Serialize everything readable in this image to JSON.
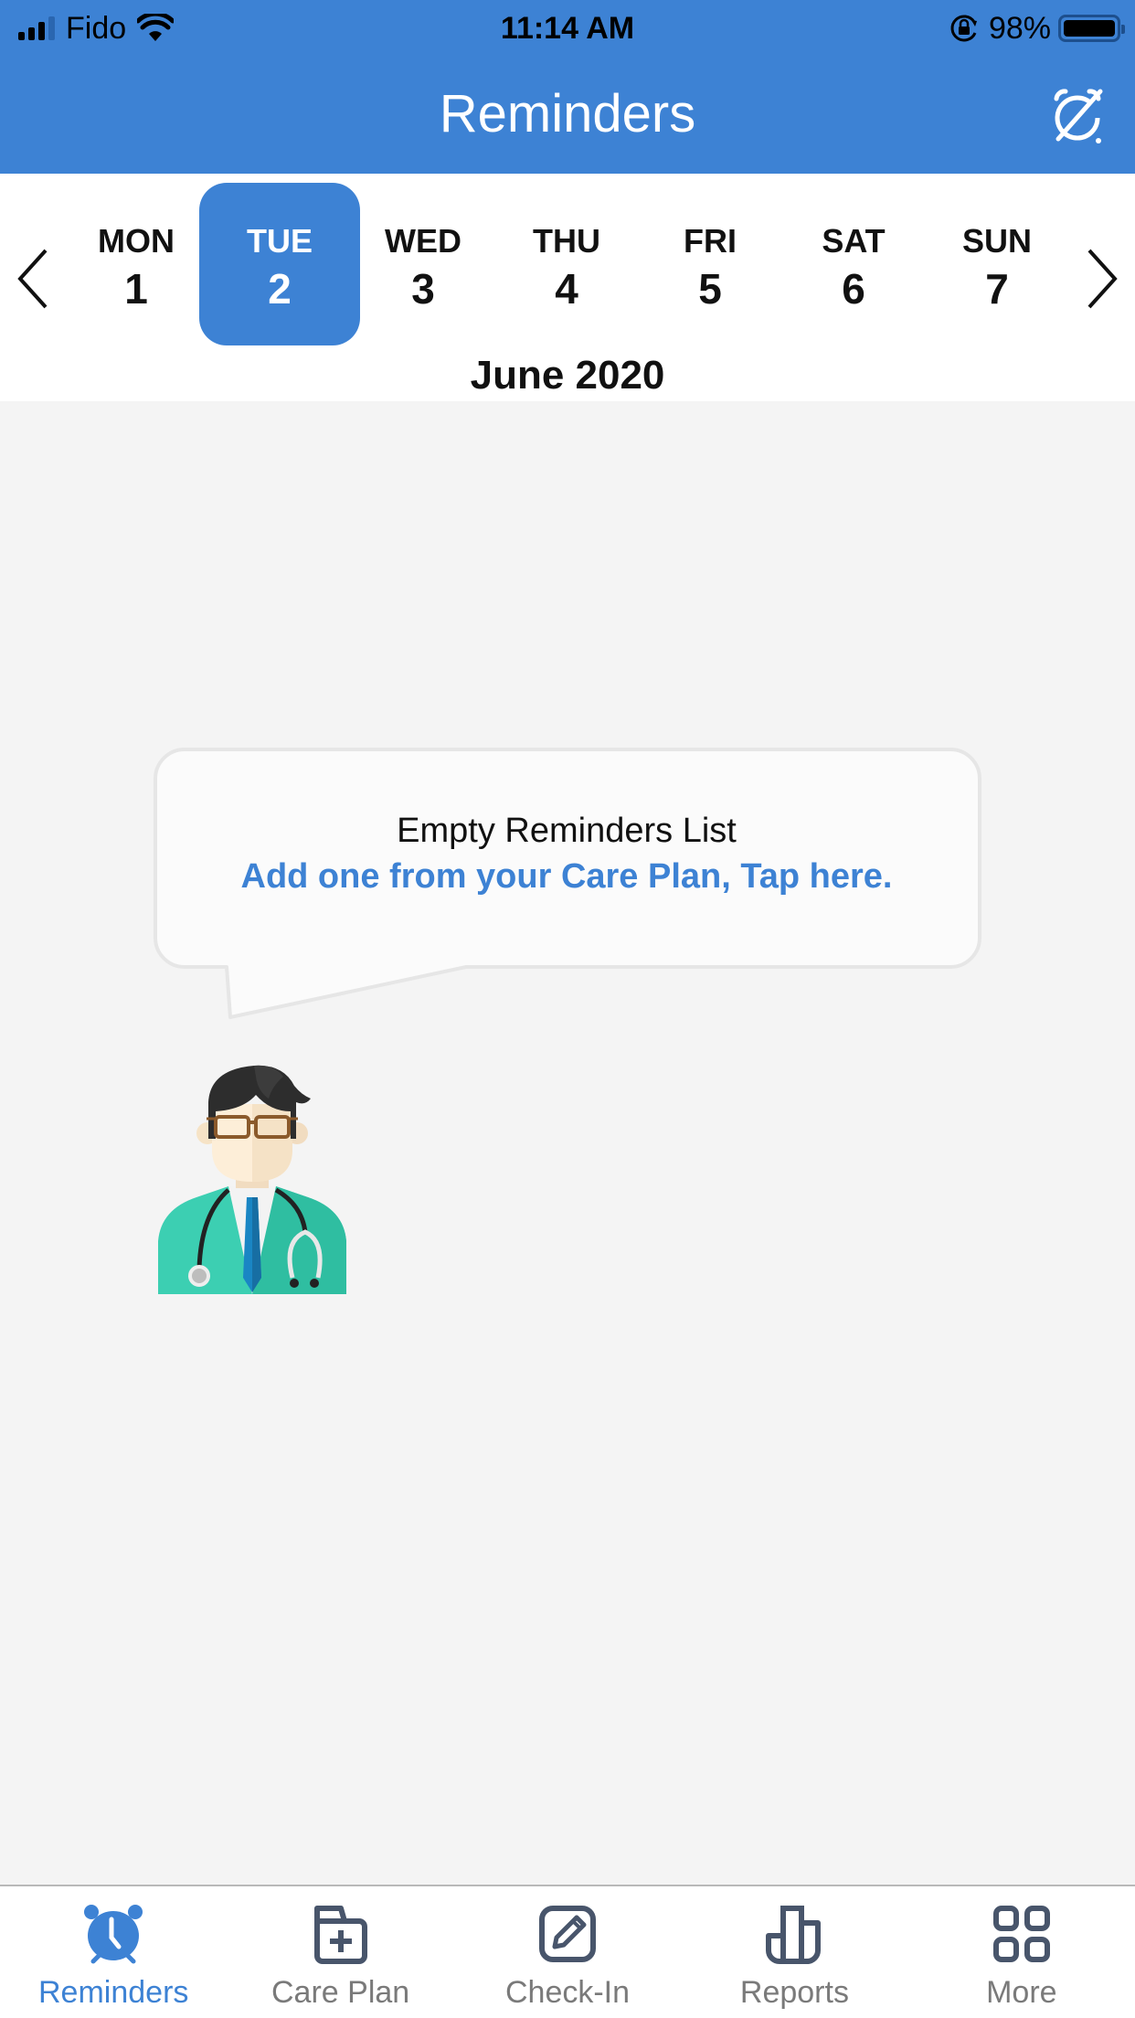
{
  "status_bar": {
    "carrier": "Fido",
    "time": "11:14 AM",
    "battery": "98%",
    "battery_level": 0.98,
    "icons": [
      "signal-icon",
      "wifi-icon",
      "orientation-lock-icon",
      "battery-icon"
    ]
  },
  "header": {
    "title": "Reminders",
    "action_icon": "alarm-off-icon"
  },
  "calendar": {
    "prev_icon": "chevron-left-icon",
    "next_icon": "chevron-right-icon",
    "days": [
      {
        "name": "MON",
        "num": "1",
        "selected": false
      },
      {
        "name": "TUE",
        "num": "2",
        "selected": true
      },
      {
        "name": "WED",
        "num": "3",
        "selected": false
      },
      {
        "name": "THU",
        "num": "4",
        "selected": false
      },
      {
        "name": "FRI",
        "num": "5",
        "selected": false
      },
      {
        "name": "SAT",
        "num": "6",
        "selected": false
      },
      {
        "name": "SUN",
        "num": "7",
        "selected": false
      }
    ],
    "month": "June 2020"
  },
  "empty_state": {
    "title": "Empty Reminders List",
    "link": "Add one from your Care Plan, Tap here.",
    "illustration": "doctor-avatar"
  },
  "tabbar": {
    "tabs": [
      {
        "label": "Reminders",
        "icon": "alarm-clock-icon",
        "active": true
      },
      {
        "label": "Care Plan",
        "icon": "medical-folder-icon",
        "active": false
      },
      {
        "label": "Check-In",
        "icon": "edit-icon",
        "active": false
      },
      {
        "label": "Reports",
        "icon": "bar-chart-icon",
        "active": false
      },
      {
        "label": "More",
        "icon": "grid-icon",
        "active": false
      }
    ]
  },
  "colors": {
    "primary": "#3d82d4",
    "background": "#f4f4f4",
    "tab_inactive_icon": "#48556b",
    "tab_inactive_label": "#7a7a7a"
  }
}
